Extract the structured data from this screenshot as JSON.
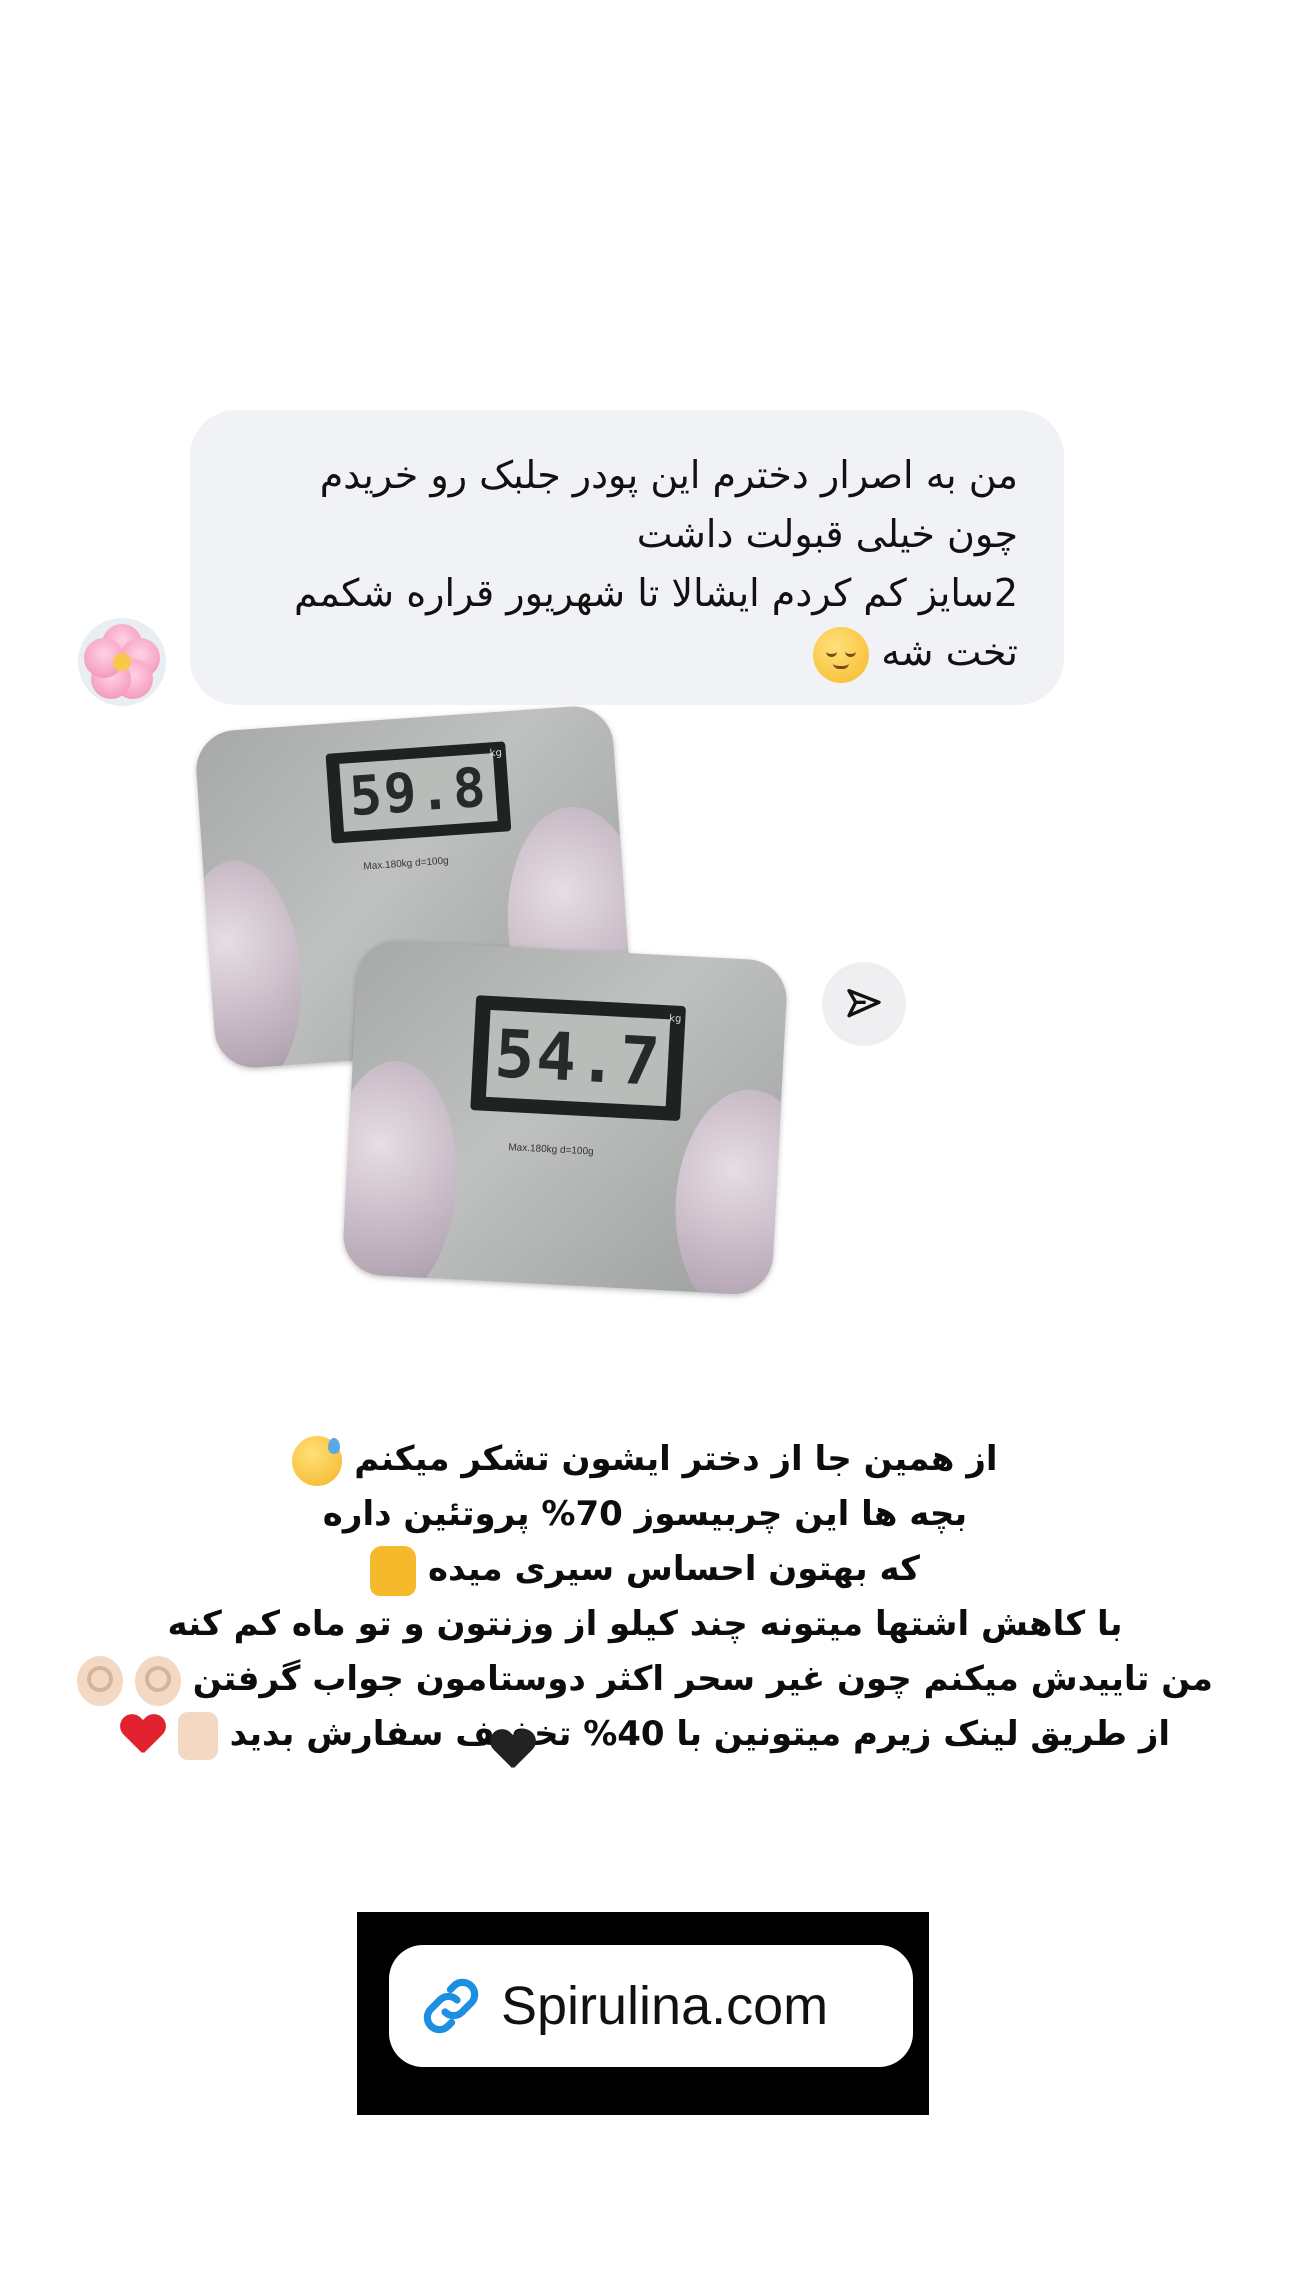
{
  "chat": {
    "avatar": {
      "icon": "cherry-blossom-icon"
    },
    "message_lines": [
      "من به اصرار دخترم این پودر جلبک رو خریدم",
      "چون خیلی قبولت داشت",
      "2سایز کم کردم ایشالا تا شهریور قراره شکمم",
      "تخت شه"
    ],
    "message_emoji": "relieved-face-icon",
    "photos": [
      {
        "reading": "59.8",
        "unit": "kg",
        "label": "Max.180kg  d=100g"
      },
      {
        "reading": "54.7",
        "unit": "kg",
        "label": "Max.180kg  d=100g"
      }
    ],
    "send_icon": "paper-plane-icon"
  },
  "caption": {
    "lines": [
      "از همین جا از دختر ایشون تشکر میکنم",
      "بچه ها این چربیسوز 70% پروتئین داره",
      "که بهتون احساس سیری میده",
      "با کاهش اشتها میتونه چند کیلو از وزنتون و تو  ماه کم کنه",
      "من تاییدش میکنم چون غیر سحر اکثر دوستامون جواب گرفتن",
      "از طریق لینک زیرم میتونین با 40% تخفیف سفارش بدید"
    ]
  },
  "link_sticker": {
    "text": "Spirulina.com",
    "icon": "link-icon",
    "accent": "#1d8fe1"
  },
  "colors": {
    "bubble": "#f1f2f5",
    "background": "#ffffff",
    "link_card": "#000000"
  }
}
